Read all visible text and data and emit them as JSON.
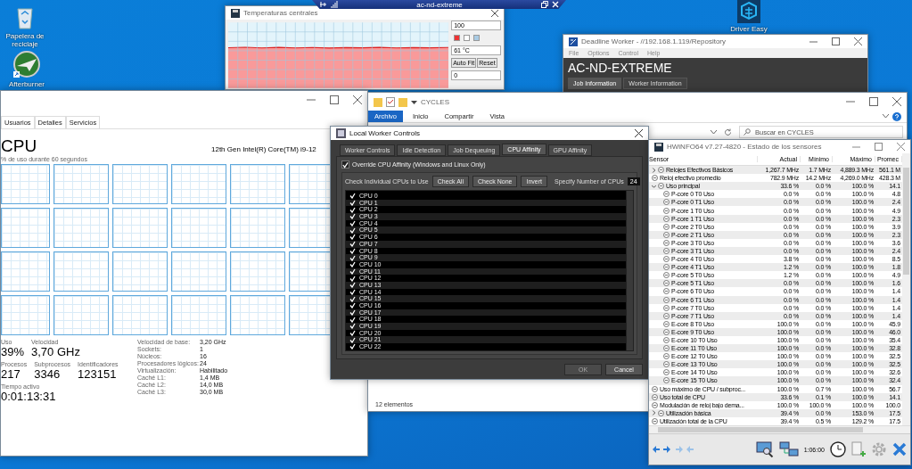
{
  "desktop_icons": [
    {
      "label": "Papelera de reciclaje",
      "kind": "bin"
    },
    {
      "label": "Afterburner",
      "kind": "plane"
    },
    {
      "label": "Driver Easy",
      "kind": "cube"
    }
  ],
  "remote_bar": {
    "title": "ac-nd-extreme"
  },
  "temperature_window": {
    "title": "Temperaturas centrales",
    "max": "100",
    "reading": "61 °C",
    "min": "0",
    "buttons": [
      "Auto Fit",
      "Reset"
    ]
  },
  "deadline_window": {
    "title": "Deadline Worker  -  //192.168.1.119/Repository",
    "menu": [
      "File",
      "Options",
      "Control",
      "Help"
    ],
    "worker_name": "AC-ND-EXTREME",
    "tabs": [
      {
        "label": "Job Information",
        "selected": true
      },
      {
        "label": "Worker Information",
        "selected": false
      }
    ]
  },
  "task_manager": {
    "tabs": [
      {
        "label": "Usuarios",
        "selected": false
      },
      {
        "label": "Detalles",
        "selected": false
      },
      {
        "label": "Servicios",
        "selected": false
      }
    ],
    "heading": "CPU",
    "processor": "12th Gen Intel(R) Core(TM) i9-12",
    "graph_caption": "% de uso durante 60 segundos",
    "stats": [
      [
        {
          "label": "Uso",
          "value": "39%"
        },
        {
          "label": "Velocidad",
          "value": "3,70 GHz"
        }
      ],
      [
        {
          "label": "Procesos",
          "value": "217"
        },
        {
          "label": "Subprocesos",
          "value": "3346"
        },
        {
          "label": "Identificadores",
          "value": "123151"
        }
      ],
      [
        {
          "label": "Tiempo activo",
          "value": "0:01:13:31"
        }
      ]
    ],
    "details": [
      {
        "label": "Velocidad de base:",
        "value": "3,20 GHz"
      },
      {
        "label": "Sockets:",
        "value": "1"
      },
      {
        "label": "Núcleos:",
        "value": "16"
      },
      {
        "label": "Procesadores lógicos:",
        "value": "24"
      },
      {
        "label": "Virtualización:",
        "value": "Habilitado"
      },
      {
        "label": "Caché L1:",
        "value": "1,4 MB"
      },
      {
        "label": "Caché L2:",
        "value": "14,0 MB"
      },
      {
        "label": "Caché L3:",
        "value": "30,0 MB"
      }
    ]
  },
  "explorer": {
    "title": "CYCLES",
    "ribbon_tabs": [
      {
        "label": "Archivo",
        "selected": true
      },
      {
        "label": "Inicio",
        "selected": false
      },
      {
        "label": "Compartir",
        "selected": false
      },
      {
        "label": "Vista",
        "selected": false
      }
    ],
    "search": {
      "placeholder": "Buscar en CYCLES"
    },
    "status": "12 elementos"
  },
  "worker_controls": {
    "title": "Local Worker Controls",
    "tabs": [
      {
        "label": "Worker Controls",
        "selected": false
      },
      {
        "label": "Idle Detection",
        "selected": false
      },
      {
        "label": "Job Dequeuing",
        "selected": false
      },
      {
        "label": "CPU Affinity",
        "selected": true
      },
      {
        "label": "GPU Affinity",
        "selected": false
      }
    ],
    "override": {
      "label": "Override CPU Affinity (Windows and Linux Only)",
      "checked": true
    },
    "cpu_caption": "Check Individual CPUs to Use",
    "buttons": [
      "Check All",
      "Check None",
      "Invert"
    ],
    "count_label": "Specify Number of CPUs",
    "count": "24",
    "cpus": [
      {
        "label": "CPU 0",
        "checked": true
      },
      {
        "label": "CPU 1",
        "checked": true
      },
      {
        "label": "CPU 2",
        "checked": true
      },
      {
        "label": "CPU 3",
        "checked": true
      },
      {
        "label": "CPU 4",
        "checked": true
      },
      {
        "label": "CPU 5",
        "checked": true
      },
      {
        "label": "CPU 6",
        "checked": true
      },
      {
        "label": "CPU 7",
        "checked": true
      },
      {
        "label": "CPU 8",
        "checked": true
      },
      {
        "label": "CPU 9",
        "checked": true
      },
      {
        "label": "CPU 10",
        "checked": true
      },
      {
        "label": "CPU 11",
        "checked": true
      },
      {
        "label": "CPU 12",
        "checked": true
      },
      {
        "label": "CPU 13",
        "checked": true
      },
      {
        "label": "CPU 14",
        "checked": true
      },
      {
        "label": "CPU 15",
        "checked": true
      },
      {
        "label": "CPU 16",
        "checked": true
      },
      {
        "label": "CPU 17",
        "checked": true
      },
      {
        "label": "CPU 18",
        "checked": true
      },
      {
        "label": "CPU 19",
        "checked": true
      },
      {
        "label": "CPU 20",
        "checked": true
      },
      {
        "label": "CPU 21",
        "checked": true
      },
      {
        "label": "CPU 22",
        "checked": true
      }
    ],
    "footer_buttons": [
      {
        "label": "OK",
        "disabled": true
      },
      {
        "label": "Cancel",
        "disabled": false
      }
    ]
  },
  "hwinfo": {
    "title": "HWiNFO64 v7.27-4820 - Estado de los sensores",
    "columns": [
      "Sensor",
      "Actual",
      "Mínimo",
      "Máximo",
      "Promec"
    ],
    "rows": [
      {
        "sensor": "Relojes Efectivos Básicos",
        "values": [
          "1,267.7 MHz",
          "1.7 MHz",
          "4,889.3 MHz",
          "561.1 M"
        ],
        "expanded": false
      },
      {
        "sensor": "Reloj efectivo promedio",
        "values": [
          "782.9 MHz",
          "14.2 MHz",
          "4,269.0 MHz",
          "428.3 M"
        ]
      },
      {
        "sensor": "Uso principal",
        "values": [
          "33.6 %",
          "0.0 %",
          "100.0 %",
          "14.1"
        ],
        "expanded": true,
        "children": [
          {
            "sensor": "P-core 0 T0 Uso",
            "values": [
              "0.0 %",
              "0.0 %",
              "100.0 %",
              "4.8"
            ]
          },
          {
            "sensor": "P-core 0 T1 Uso",
            "values": [
              "0.0 %",
              "0.0 %",
              "100.0 %",
              "2.4"
            ]
          },
          {
            "sensor": "P-core 1 T0 Uso",
            "values": [
              "0.0 %",
              "0.0 %",
              "100.0 %",
              "4.9"
            ]
          },
          {
            "sensor": "P-core 1 T1 Uso",
            "values": [
              "0.0 %",
              "0.0 %",
              "100.0 %",
              "2.3"
            ]
          },
          {
            "sensor": "P-core 2 T0 Uso",
            "values": [
              "0.0 %",
              "0.0 %",
              "100.0 %",
              "3.9"
            ]
          },
          {
            "sensor": "P-core 2 T1 Uso",
            "values": [
              "0.0 %",
              "0.0 %",
              "100.0 %",
              "2.3"
            ]
          },
          {
            "sensor": "P-core 3 T0 Uso",
            "values": [
              "0.0 %",
              "0.0 %",
              "100.0 %",
              "3.6"
            ]
          },
          {
            "sensor": "P-core 3 T1 Uso",
            "values": [
              "0.0 %",
              "0.0 %",
              "100.0 %",
              "2.4"
            ]
          },
          {
            "sensor": "P-core 4 T0 Uso",
            "values": [
              "3.8 %",
              "0.0 %",
              "100.0 %",
              "8.5"
            ]
          },
          {
            "sensor": "P-core 4 T1 Uso",
            "values": [
              "1.2 %",
              "0.0 %",
              "100.0 %",
              "1.8"
            ]
          },
          {
            "sensor": "P-core 5 T0 Uso",
            "values": [
              "1.2 %",
              "0.0 %",
              "100.0 %",
              "4.9"
            ]
          },
          {
            "sensor": "P-core 5 T1 Uso",
            "values": [
              "0.0 %",
              "0.0 %",
              "100.0 %",
              "1.6"
            ]
          },
          {
            "sensor": "P-core 6 T0 Uso",
            "values": [
              "0.0 %",
              "0.0 %",
              "100.0 %",
              "1.4"
            ]
          },
          {
            "sensor": "P-core 6 T1 Uso",
            "values": [
              "0.0 %",
              "0.0 %",
              "100.0 %",
              "1.4"
            ]
          },
          {
            "sensor": "P-core 7 T0 Uso",
            "values": [
              "0.0 %",
              "0.0 %",
              "100.0 %",
              "1.4"
            ]
          },
          {
            "sensor": "P-core 7 T1 Uso",
            "values": [
              "0.0 %",
              "0.0 %",
              "100.0 %",
              "1.4"
            ]
          },
          {
            "sensor": "E-core 8 T0 Uso",
            "values": [
              "100.0 %",
              "0.0 %",
              "100.0 %",
              "45.9"
            ]
          },
          {
            "sensor": "E-core 9 T0 Uso",
            "values": [
              "100.0 %",
              "0.0 %",
              "100.0 %",
              "46.0"
            ]
          },
          {
            "sensor": "E-core 10 T0 Uso",
            "values": [
              "100.0 %",
              "0.0 %",
              "100.0 %",
              "35.4"
            ]
          },
          {
            "sensor": "E-core 11 T0 Uso",
            "values": [
              "100.0 %",
              "0.0 %",
              "100.0 %",
              "32.8"
            ]
          },
          {
            "sensor": "E-core 12 T0 Uso",
            "values": [
              "100.0 %",
              "0.0 %",
              "100.0 %",
              "32.5"
            ]
          },
          {
            "sensor": "E-core 13 T0 Uso",
            "values": [
              "100.0 %",
              "0.0 %",
              "100.0 %",
              "32.5"
            ]
          },
          {
            "sensor": "E-core 14 T0 Uso",
            "values": [
              "100.0 %",
              "0.0 %",
              "100.0 %",
              "32.6"
            ]
          },
          {
            "sensor": "E-core 15 T0 Uso",
            "values": [
              "100.0 %",
              "0.0 %",
              "100.0 %",
              "32.4"
            ]
          }
        ]
      },
      {
        "sensor": "Uso máximo de CPU / subproc...",
        "values": [
          "100.0 %",
          "0.7 %",
          "100.0 %",
          "56.7"
        ]
      },
      {
        "sensor": "Uso total de CPU",
        "values": [
          "33.6 %",
          "0.1 %",
          "100.0 %",
          "14.1"
        ]
      },
      {
        "sensor": "Modulación de reloj bajo dema...",
        "values": [
          "100.0 %",
          "100.0 %",
          "100.0 %",
          "100.0"
        ]
      },
      {
        "sensor": "Utilización básica",
        "values": [
          "39.4 %",
          "0.0 %",
          "153.0 %",
          "17.5"
        ],
        "expanded": false
      },
      {
        "sensor": "Utilización total de la CPU",
        "values": [
          "39.4 %",
          "0.5 %",
          "129.2 %",
          "17.5"
        ]
      }
    ],
    "timer": "1:06:00"
  }
}
